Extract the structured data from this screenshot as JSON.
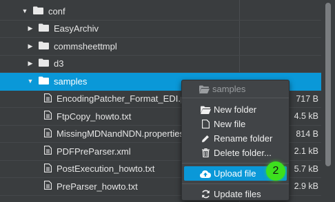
{
  "tree": {
    "root": {
      "label": "conf"
    },
    "folders": [
      {
        "label": "EasyArchiv"
      },
      {
        "label": "commsheettmpl"
      },
      {
        "label": "d3"
      }
    ],
    "selected_folder": {
      "label": "samples"
    },
    "files": [
      {
        "label": "EncodingPatcher_Format_EDI.properties",
        "size": "717 B"
      },
      {
        "label": "FtpCopy_howto.txt",
        "size": "4.5 kB"
      },
      {
        "label": "MissingMDNandNDN.properties",
        "size": "814 B"
      },
      {
        "label": "PDFPreParser.xml",
        "size": "2.1 kB"
      },
      {
        "label": "PostExecution_howto.txt",
        "size": "5.7 kB"
      },
      {
        "label": "PreParser_howto.txt",
        "size": "2.9 kB"
      }
    ]
  },
  "context_menu": {
    "header": "samples",
    "items": [
      {
        "label": "New folder",
        "icon": "folder-open-icon"
      },
      {
        "label": "New file",
        "icon": "file-icon"
      },
      {
        "label": "Rename folder",
        "icon": "pencil-icon"
      },
      {
        "label": "Delete folder...",
        "icon": "trash-icon"
      }
    ],
    "upload": {
      "label": "Upload file",
      "icon": "cloud-upload-icon"
    },
    "update": {
      "label": "Update files",
      "icon": "refresh-icon"
    }
  },
  "step_badge": "2",
  "colors": {
    "selection": "#0a98d8",
    "background": "#3a3d3f",
    "badge": "#3de01e"
  }
}
